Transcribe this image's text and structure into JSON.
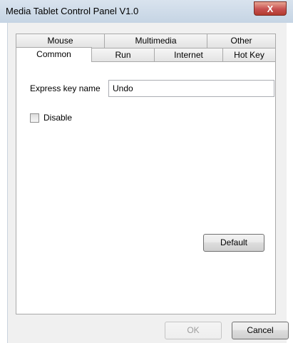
{
  "window": {
    "title": "Media Tablet Control Panel V1.0",
    "close_glyph": "X"
  },
  "tabs": {
    "back_row": [
      {
        "label": "Mouse"
      },
      {
        "label": "Multimedia"
      },
      {
        "label": "Other"
      }
    ],
    "front_row": [
      {
        "label": "Common",
        "active": true
      },
      {
        "label": "Run"
      },
      {
        "label": "Internet"
      },
      {
        "label": "Hot Key"
      }
    ]
  },
  "common": {
    "express_key_label": "Express key name",
    "express_key_value": "Undo",
    "disable_label": "Disable",
    "disable_checked": false,
    "default_button": "Default"
  },
  "dialog": {
    "ok_label": "OK",
    "ok_enabled": false,
    "cancel_label": "Cancel"
  }
}
